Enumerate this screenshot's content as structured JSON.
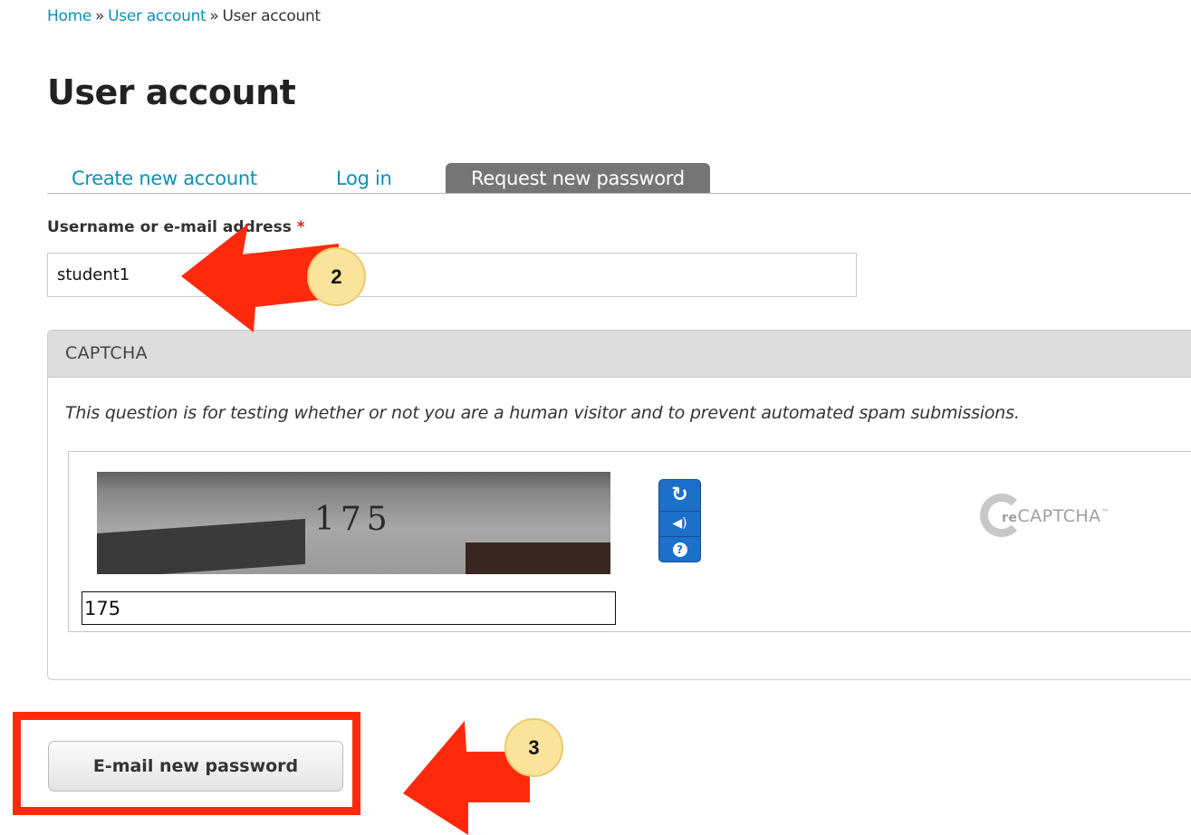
{
  "breadcrumb": {
    "home": "Home",
    "sep1": "»",
    "user_account_link": "User account",
    "sep2": "»",
    "current": "User account"
  },
  "page_title": "User account",
  "tabs": [
    {
      "label": "Create new account"
    },
    {
      "label": "Log in"
    },
    {
      "label": "Request new password",
      "active": true
    }
  ],
  "form": {
    "username_label": "Username or e-mail address",
    "required_marker": "*",
    "username_value": "student1"
  },
  "captcha": {
    "legend": "CAPTCHA",
    "description": "This question is for testing whether or not you are a human visitor and to prevent automated spam submissions.",
    "image_text": "175",
    "answer_value": "175",
    "refresh_icon": "↻",
    "audio_icon": "◀)",
    "help_icon": "?",
    "logo_prefix": "re",
    "logo_name": "CAPTCHA",
    "logo_tm": "™"
  },
  "submit_label": "E-mail new password",
  "annotations": {
    "badge_2": "2",
    "badge_3": "3"
  },
  "colors": {
    "link": "#0d8fb8",
    "active_tab": "#757575",
    "annotation_red": "#ff2a0d",
    "badge": "#fae39a",
    "recaptcha_blue": "#1c70c9"
  }
}
